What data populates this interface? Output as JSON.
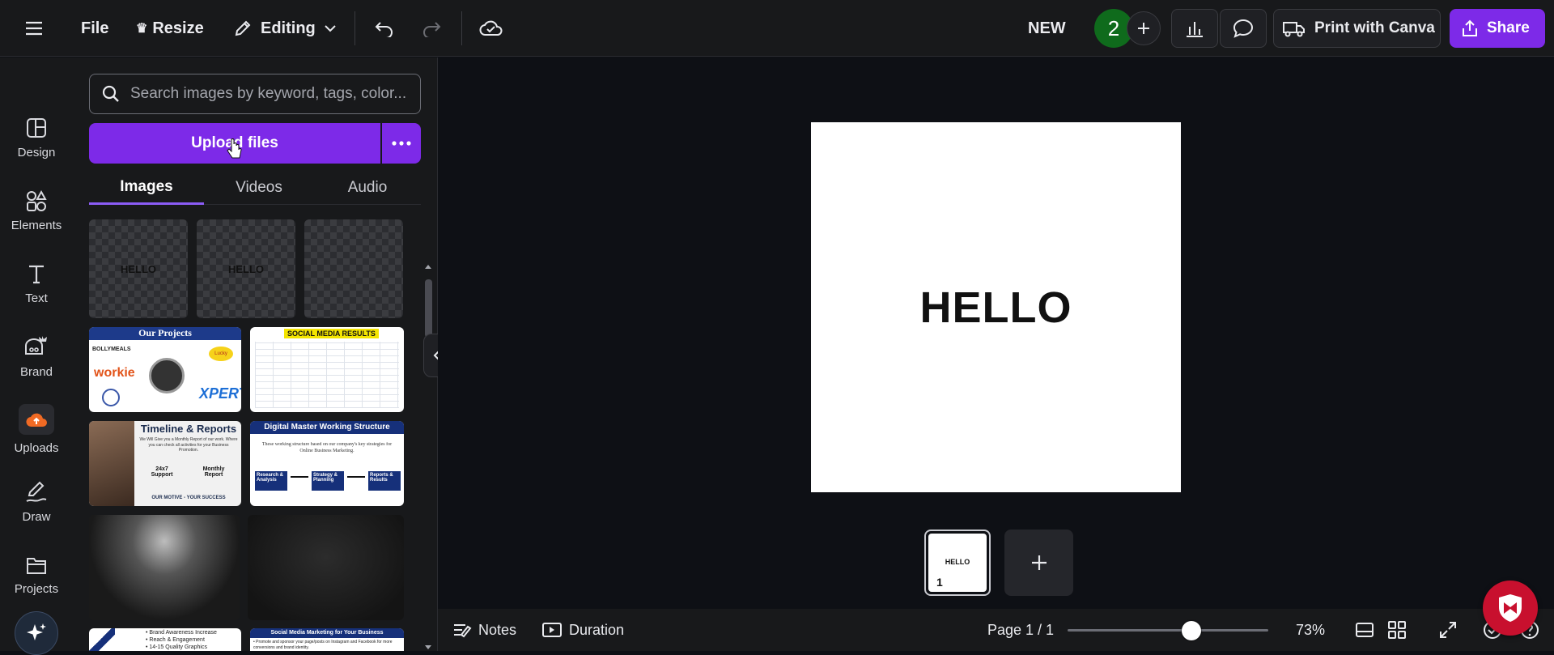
{
  "topbar": {
    "file_label": "File",
    "resize_label": "Resize",
    "editing_label": "Editing",
    "doc_title": "NEW",
    "collaborator_badge": "2",
    "print_label": "Print with Canva",
    "share_label": "Share",
    "brand_color": "#7d2ae8"
  },
  "leftnav": {
    "items": [
      {
        "label": "Design",
        "icon": "design-icon"
      },
      {
        "label": "Elements",
        "icon": "elements-icon"
      },
      {
        "label": "Text",
        "icon": "text-icon"
      },
      {
        "label": "Brand",
        "icon": "brand-icon"
      },
      {
        "label": "Uploads",
        "icon": "uploads-icon"
      },
      {
        "label": "Draw",
        "icon": "draw-icon"
      },
      {
        "label": "Projects",
        "icon": "projects-icon"
      }
    ]
  },
  "panel": {
    "search_placeholder": "Search images by keyword, tags, color...",
    "upload_label": "Upload files",
    "tabs": [
      {
        "label": "Images",
        "active": true
      },
      {
        "label": "Videos",
        "active": false
      },
      {
        "label": "Audio",
        "active": false
      }
    ],
    "thumbs": {
      "hello1": "HELLO",
      "hello2": "HELLO",
      "projects_title": "Our Projects",
      "projects_brands": [
        "BOLLYMEALS",
        "workie",
        "XPERT",
        "Lucky"
      ],
      "social_title": "SOCIAL MEDIA RESULTS",
      "timeline_title": "Timeline & Reports",
      "timeline_text": "We Will Give you a Monthly Report of our work. Where you can check all activities for your Business Promotion.",
      "timeline_support": "24x7 Support",
      "timeline_monthly": "Monthly Report",
      "timeline_motive": "OUR MOTIVE - YOUR SUCCESS",
      "dmws_title": "Digital Master Working Structure",
      "dmws_text": "These working structure based on our company's key strategies for Online Business Marketing.",
      "dmws_steps": [
        "Research & Analysis",
        "Strategy & Planning",
        "Reports & Results"
      ],
      "brand_lines": [
        "• Brand Awareness Increase",
        "• Reach & Engagement",
        "• 14-15 Quality Graphics"
      ],
      "smm_title": "Social Media Marketing for Your Business",
      "smm_text": "• Promote and sponsor your page/posts on Instagram and Facebook for more conversions and brand identity."
    }
  },
  "canvas": {
    "page_text": "HELLO"
  },
  "pages": {
    "thumb_text": "HELLO",
    "thumb_number": "1"
  },
  "bottombar": {
    "notes_label": "Notes",
    "duration_label": "Duration",
    "page_indicator": "Page 1 / 1",
    "zoom_level": 0.73,
    "zoom_label": "73%"
  }
}
